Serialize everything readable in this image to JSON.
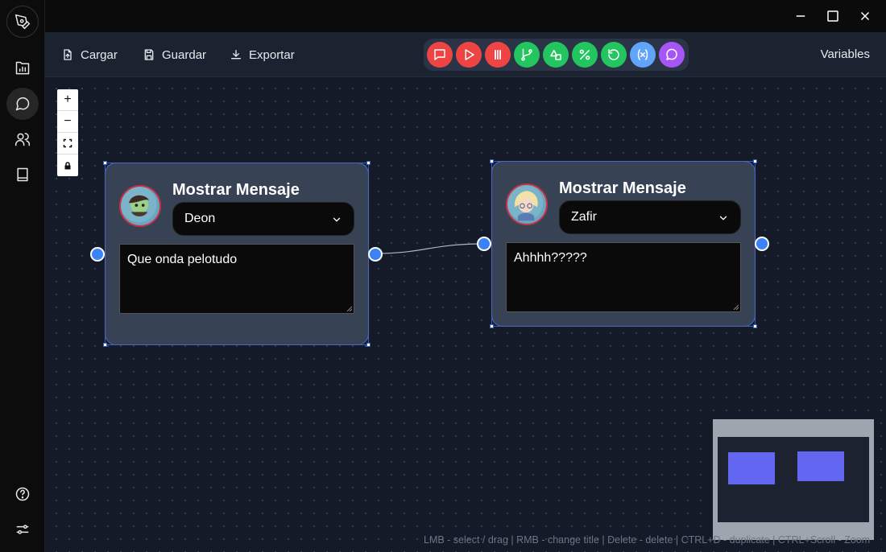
{
  "sidebar": {
    "items": [
      {
        "name": "logo",
        "icon": "pen-tool-icon"
      },
      {
        "name": "projects",
        "icon": "folder-chart-icon"
      },
      {
        "name": "dialogues",
        "icon": "chat-bubble-icon"
      },
      {
        "name": "characters",
        "icon": "users-icon"
      },
      {
        "name": "book",
        "icon": "book-icon"
      },
      {
        "name": "help",
        "icon": "help-circle-icon"
      },
      {
        "name": "settings",
        "icon": "sliders-icon"
      }
    ]
  },
  "toolbar": {
    "load_label": "Cargar",
    "save_label": "Guardar",
    "export_label": "Exportar",
    "variables_label": "Variables",
    "tools": [
      {
        "name": "message",
        "icon": "message-square-icon",
        "color": "#ef4444"
      },
      {
        "name": "play",
        "icon": "play-icon",
        "color": "#ef4444"
      },
      {
        "name": "pause",
        "icon": "pause-icon",
        "color": "#ef4444"
      },
      {
        "name": "branch",
        "icon": "git-branch-icon",
        "color": "#22c55e"
      },
      {
        "name": "shapes",
        "icon": "shapes-icon",
        "color": "#22c55e"
      },
      {
        "name": "percent",
        "icon": "percent-icon",
        "color": "#22c55e"
      },
      {
        "name": "loop",
        "icon": "rotate-ccw-icon",
        "color": "#22c55e"
      },
      {
        "name": "variable",
        "icon": "variable-icon",
        "color": "#60a5fa"
      },
      {
        "name": "comment",
        "icon": "message-circle-icon",
        "color": "#a855f7"
      }
    ]
  },
  "nodes": [
    {
      "title": "Mostrar Mensaje",
      "character": "Deon",
      "message": "Que onda pelotudo"
    },
    {
      "title": "Mostrar Mensaje",
      "character": "Zafir",
      "message": "Ahhhh?????"
    }
  ],
  "zoom_controls": [
    "+",
    "−"
  ],
  "hint": "LMB - select / drag | RMB - change title | Delete - delete | CTRL+D - duplicate | CTRL+Scroll - Zoom"
}
